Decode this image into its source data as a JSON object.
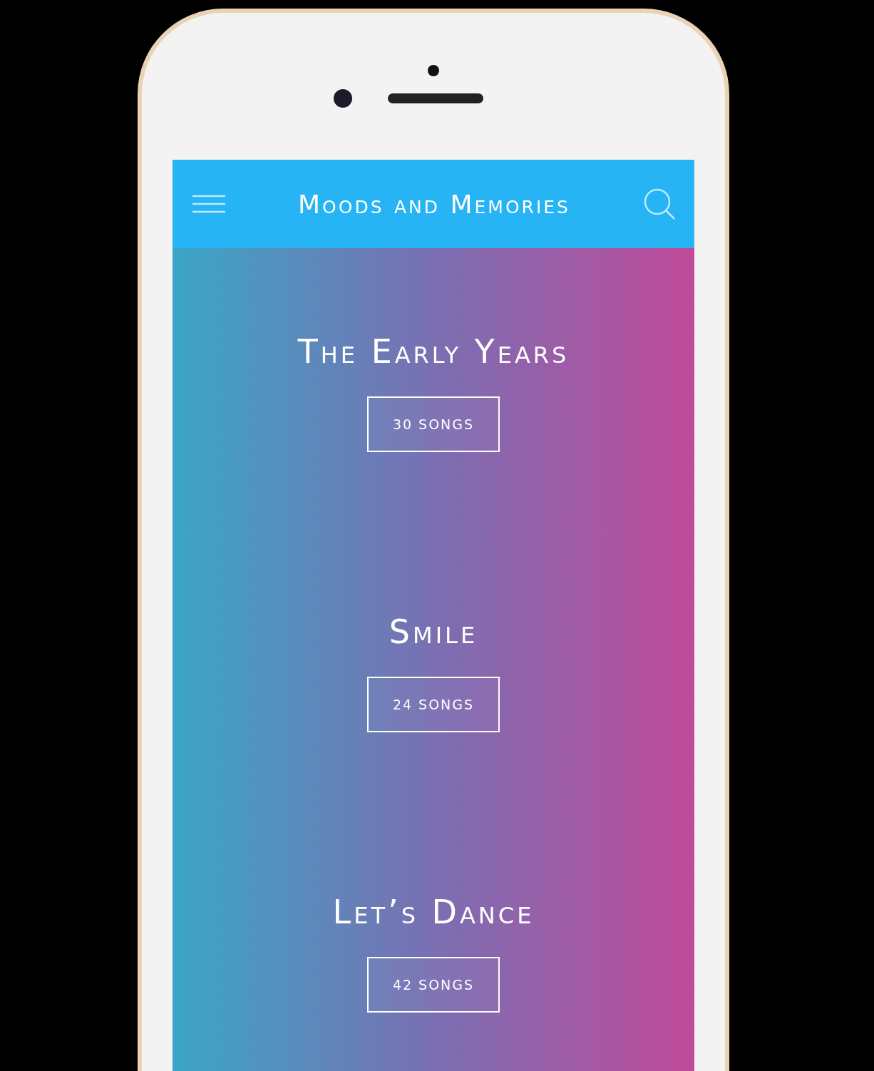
{
  "app_bar": {
    "title": "Moods and Memories"
  },
  "playlists": [
    {
      "title": "The Early Years",
      "count": "30 SONGS"
    },
    {
      "title": "Smile",
      "count": "24 SONGS"
    },
    {
      "title": "Let’s Dance",
      "count": "42 SONGS"
    }
  ]
}
